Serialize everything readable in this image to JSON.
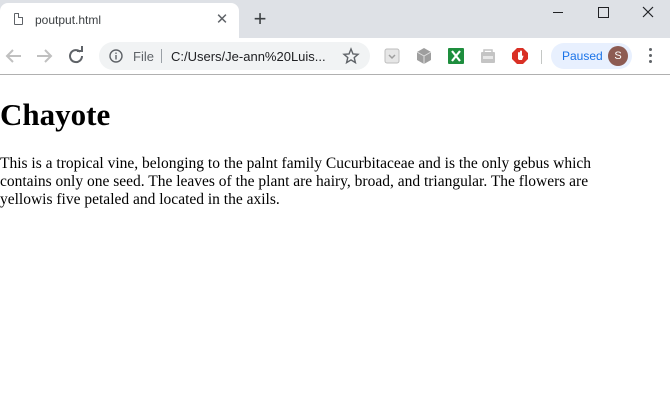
{
  "tab": {
    "title": "poutput.html"
  },
  "toolbar": {
    "scheme_label": "File",
    "url": "C:/Users/Je-ann%20Luis...",
    "profile_status": "Paused",
    "avatar_initial": "S"
  },
  "page": {
    "heading": "Chayote",
    "paragraph": "This is a tropical vine, belonging to the palnt family Cucurbitaceae and is the only gebus which contains only one seed. The leaves of the plant are hairy, broad, and triangular. The flowers are yellowis five petaled and located in the axils."
  },
  "colors": {
    "tabstrip_bg": "#dee1e6",
    "paused_chip_bg": "#e8f0fe",
    "paused_text": "#1a73e8",
    "avatar_bg": "#8d5b52"
  },
  "icons": {
    "tab_favicon": "document-icon",
    "tab_close": "close-icon",
    "new_tab": "plus-icon",
    "back": "arrow-left-icon",
    "forward": "arrow-right-icon",
    "reload": "reload-icon",
    "site_info": "info-icon",
    "bookmark": "star-icon",
    "menu": "kebab-menu-icon"
  }
}
